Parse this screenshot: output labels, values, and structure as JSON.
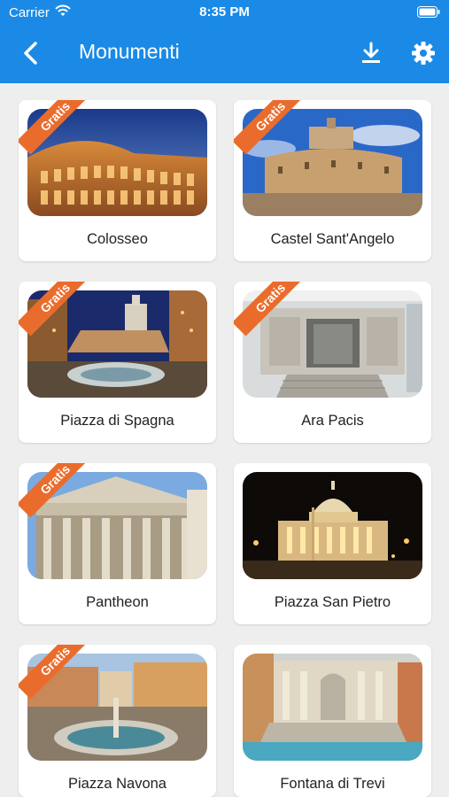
{
  "status": {
    "carrier": "Carrier",
    "time": "8:35 PM"
  },
  "nav": {
    "title": "Monumenti"
  },
  "badge_text": "Gratis",
  "colors": {
    "accent": "#1a8ae6",
    "badge": "#ea6c2c",
    "background": "#eeeeee"
  },
  "icons": {
    "back": "chevron-left-icon",
    "download": "download-icon",
    "settings": "gear-icon"
  },
  "monuments": [
    {
      "name": "Colosseo",
      "free": true
    },
    {
      "name": "Castel Sant'Angelo",
      "free": true
    },
    {
      "name": "Piazza di Spagna",
      "free": true
    },
    {
      "name": "Ara Pacis",
      "free": true
    },
    {
      "name": "Pantheon",
      "free": true
    },
    {
      "name": "Piazza San Pietro",
      "free": false
    },
    {
      "name": "Piazza Navona",
      "free": true
    },
    {
      "name": "Fontana di Trevi",
      "free": false
    }
  ]
}
